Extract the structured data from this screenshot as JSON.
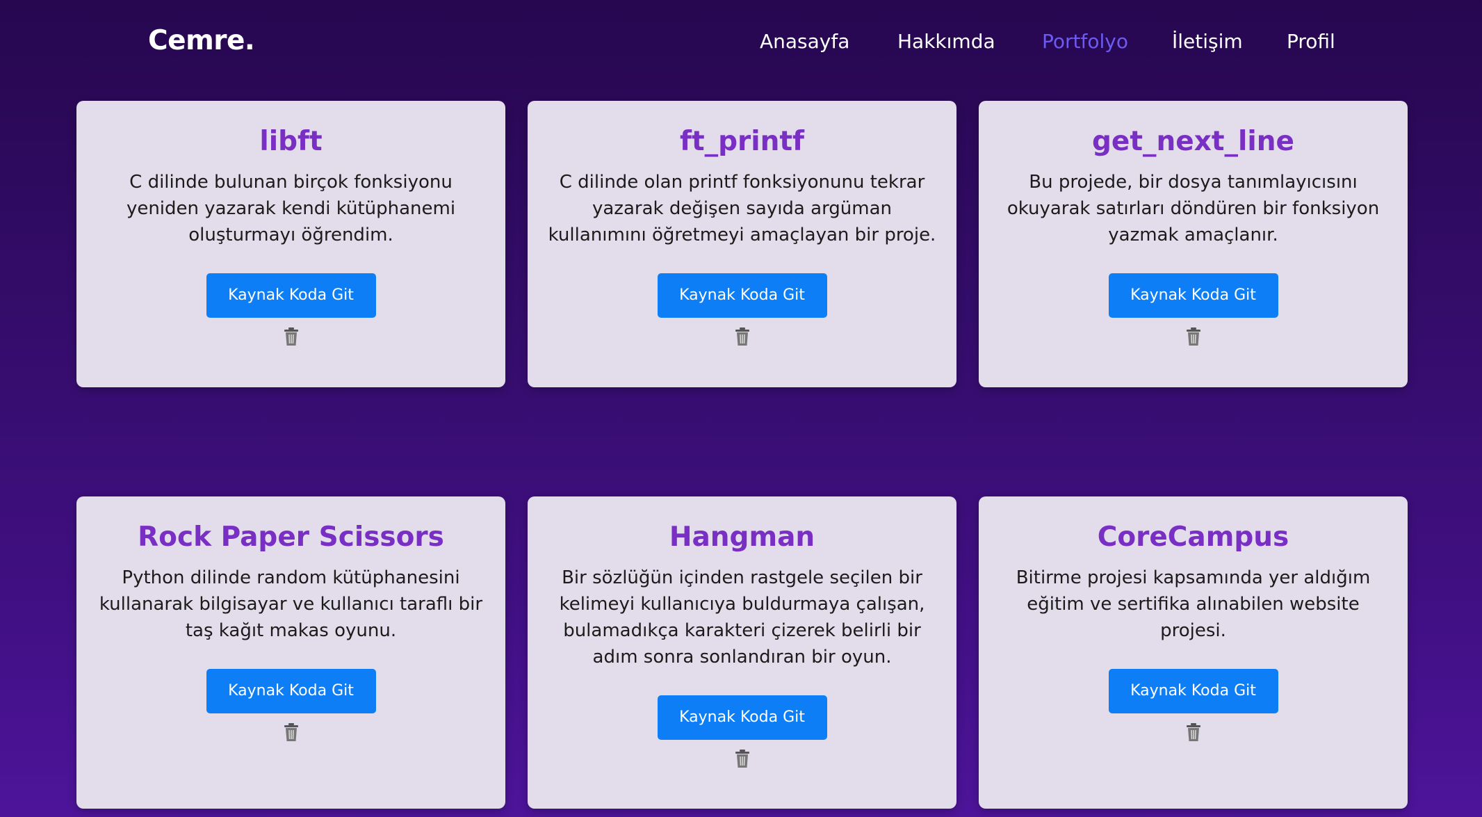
{
  "nav": {
    "brand": "Cemre.",
    "links": [
      {
        "label": "Anasayfa"
      },
      {
        "label": "Hakkımda"
      },
      {
        "label": "Portfolyo",
        "active": true
      },
      {
        "label": "İletişim"
      },
      {
        "label": "Profil"
      }
    ]
  },
  "colors": {
    "accent_title": "#7a2fc4",
    "button": "#0d7ef5",
    "active_nav": "#6a5cf0",
    "card_bg": "#e3dcea"
  },
  "projects": [
    {
      "title": "libft",
      "description": "C dilinde bulunan birçok fonksiyonu yeniden yazarak kendi kütüphanemi oluşturmayı öğrendim.",
      "button_label": "Kaynak Koda Git",
      "delete_icon": "trash-icon"
    },
    {
      "title": "ft_printf",
      "description": "C dilinde olan printf fonksiyonunu tekrar yazarak değişen sayıda argüman kullanımını öğretmeyi amaçlayan bir proje.",
      "button_label": "Kaynak Koda Git",
      "delete_icon": "trash-icon"
    },
    {
      "title": "get_next_line",
      "description": "Bu projede, bir dosya tanımlayıcısını okuyarak satırları döndüren bir fonksiyon yazmak amaçlanır.",
      "button_label": "Kaynak Koda Git",
      "delete_icon": "trash-icon"
    },
    {
      "title": "Rock Paper Scissors",
      "description": "Python dilinde random kütüphanesini kullanarak bilgisayar ve kullanıcı taraflı bir taş kağıt makas oyunu.",
      "button_label": "Kaynak Koda Git",
      "delete_icon": "trash-icon"
    },
    {
      "title": "Hangman",
      "description": "Bir sözlüğün içinden rastgele seçilen bir kelimeyi kullanıcıya buldurmaya çalışan, bulamadıkça karakteri çizerek belirli bir adım sonra sonlandıran bir oyun.",
      "button_label": "Kaynak Koda Git",
      "delete_icon": "trash-icon"
    },
    {
      "title": "CoreCampus",
      "description": "Bitirme projesi kapsamında yer aldığım eğitim ve sertifika alınabilen website projesi.",
      "button_label": "Kaynak Koda Git",
      "delete_icon": "trash-icon"
    }
  ]
}
